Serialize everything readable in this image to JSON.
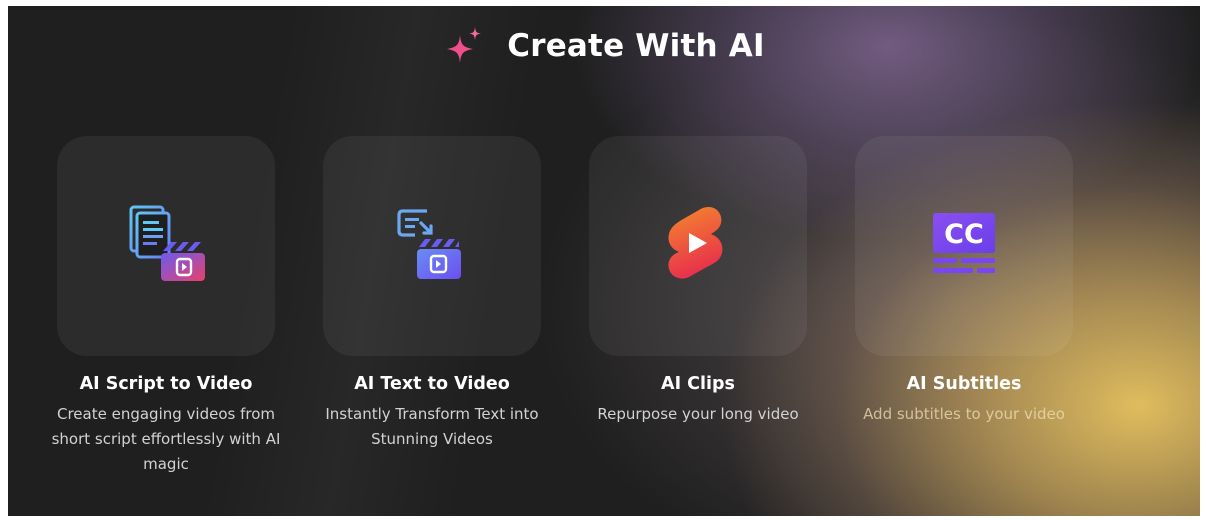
{
  "header": {
    "title": "Create With AI",
    "icon": "sparkle-icon"
  },
  "cards": [
    {
      "title": "AI Script to Video",
      "description": "Create engaging videos from short script effortlessly with AI magic",
      "icon": "script-to-video-icon"
    },
    {
      "title": "AI Text to Video",
      "description": "Instantly Transform Text into Stunning Videos",
      "icon": "text-to-video-icon"
    },
    {
      "title": "AI Clips",
      "description": "Repurpose your long video",
      "icon": "clips-icon"
    },
    {
      "title": "AI Subtitles",
      "description": "Add subtitles to your video",
      "icon": "subtitles-icon"
    }
  ],
  "colors": {
    "background": "#1f1f1f",
    "sparkle": "#f04e8c",
    "clips_orange": "#f0832a",
    "clips_red": "#e8394a",
    "subtitles_purple": "#7b46f2",
    "text_to_video_blue": "#5a6cf0"
  }
}
